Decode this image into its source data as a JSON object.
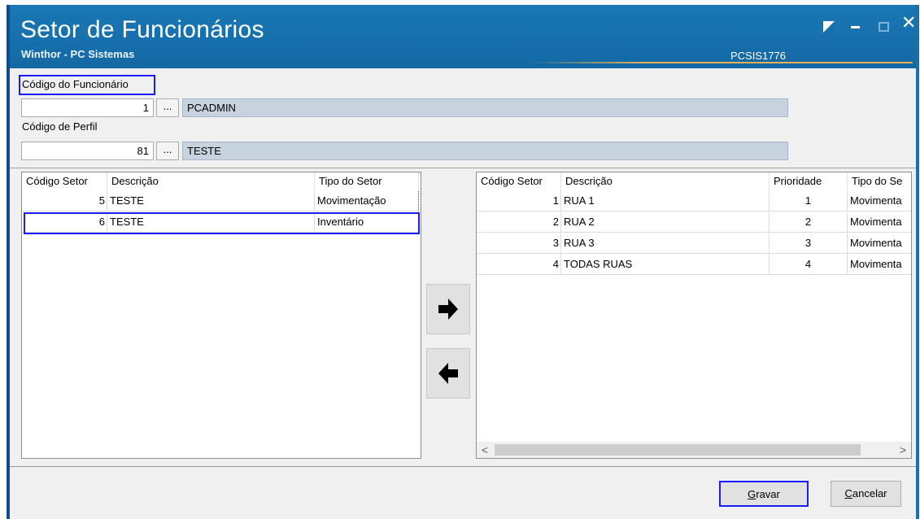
{
  "window": {
    "title": "Setor de Funcionários",
    "subtitle": "Winthor - PC Sistemas",
    "program_code": "PCSIS1776",
    "close_glyph": "✕"
  },
  "employee": {
    "label": "Código do Funcionário",
    "code": "1",
    "name": "PCADMIN",
    "lookup_label": "..."
  },
  "profile": {
    "label": "Código de Perfil",
    "code": "81",
    "name": "TESTE",
    "lookup_label": "..."
  },
  "left_grid": {
    "headers": [
      "Código Setor",
      "Descrição",
      "Tipo do Setor"
    ],
    "rows": [
      {
        "codigo": "5",
        "descricao": "TESTE",
        "tipo": "Movimentação"
      },
      {
        "codigo": "6",
        "descricao": "TESTE",
        "tipo": "Inventário"
      }
    ]
  },
  "right_grid": {
    "headers": [
      "Código Setor",
      "Descrição",
      "Prioridade",
      "Tipo do Se"
    ],
    "rows": [
      {
        "codigo": "1",
        "descricao": "RUA 1",
        "prioridade": "1",
        "tipo": "Movimenta"
      },
      {
        "codigo": "2",
        "descricao": "RUA 2",
        "prioridade": "2",
        "tipo": "Movimenta"
      },
      {
        "codigo": "3",
        "descricao": "RUA 3",
        "prioridade": "3",
        "tipo": "Movimenta"
      },
      {
        "codigo": "4",
        "descricao": "TODAS RUAS",
        "prioridade": "4",
        "tipo": "Movimenta"
      }
    ],
    "scroll_left": "<",
    "scroll_right": ">"
  },
  "footer": {
    "save_accel": "G",
    "save_rest": "ravar",
    "cancel_accel": "C",
    "cancel_rest": "ancelar"
  },
  "icons": {
    "move_right": "arrow-right-icon",
    "move_left": "arrow-left-icon"
  },
  "colors": {
    "titlebar": "#1670ad",
    "highlight": "#1a1aff",
    "readonly_field": "#c6d3de"
  }
}
